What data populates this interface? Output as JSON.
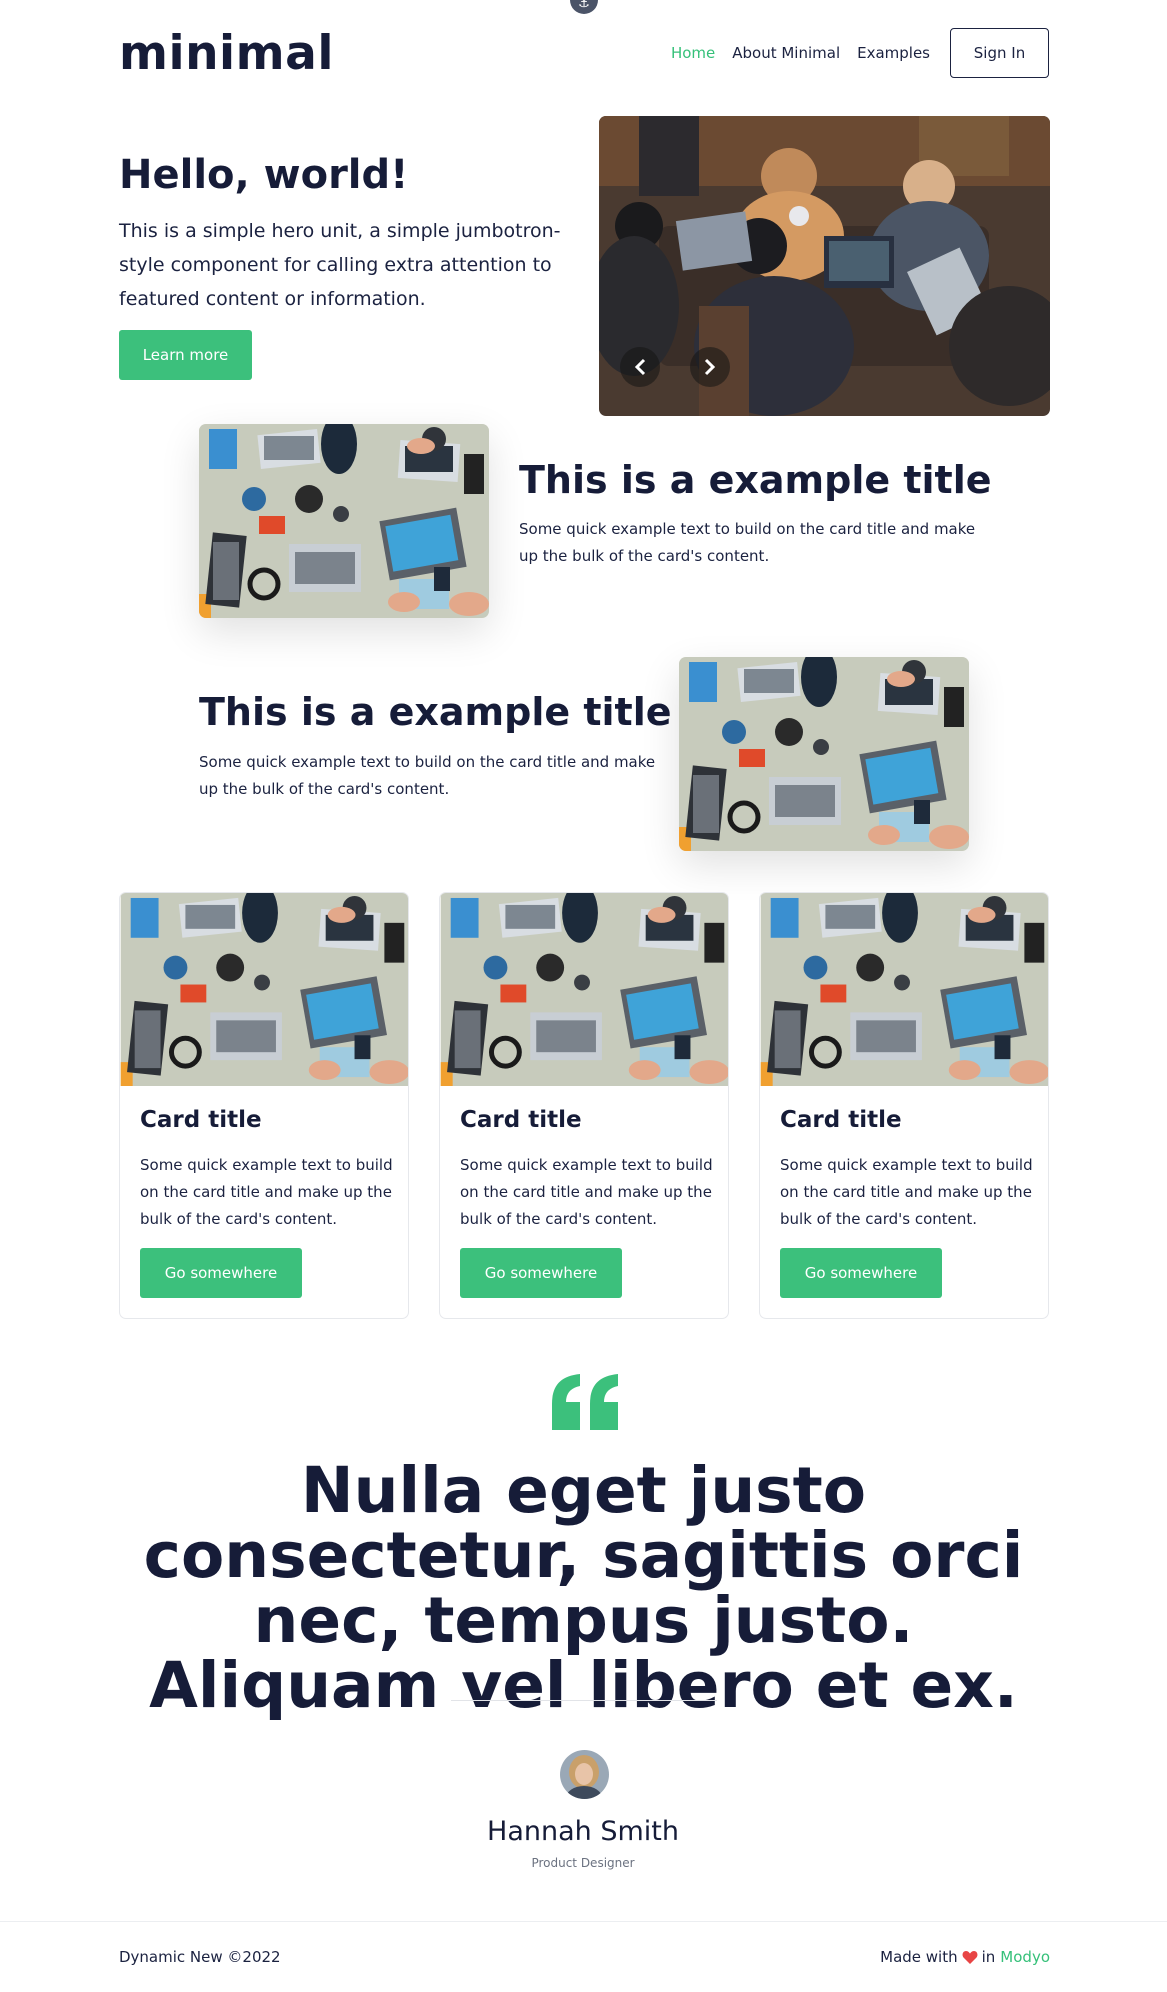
{
  "header": {
    "logo": "minimal",
    "nav": [
      {
        "label": "Home",
        "active": true
      },
      {
        "label": "About Minimal",
        "active": false
      },
      {
        "label": "Examples",
        "active": false
      }
    ],
    "signin_label": "Sign In"
  },
  "hero": {
    "title": "Hello, world!",
    "text": "This is a simple hero unit, a simple jumbotron-style component for calling extra attention to featured content or information.",
    "button_label": "Learn more"
  },
  "features": [
    {
      "title": "This is a example title",
      "text": "Some quick example text to build on the card title and make up the bulk of the card's content."
    },
    {
      "title": "This is a example title",
      "text": "Some quick example text to build on the card title and make up the bulk of the card's content."
    }
  ],
  "cards": [
    {
      "title": "Card title",
      "text": "Some quick example text to build on the card title and make up the bulk of the card's content.",
      "button_label": "Go somewhere"
    },
    {
      "title": "Card title",
      "text": "Some quick example text to build on the card title and make up the bulk of the card's content.",
      "button_label": "Go somewhere"
    },
    {
      "title": "Card title",
      "text": "Some quick example text to build on the card title and make up the bulk of the card's content.",
      "button_label": "Go somewhere"
    }
  ],
  "quote": {
    "text": "Nulla eget justo consectetur, sagittis orci nec, tempus justo. Aliquam vel libero et ex.",
    "author_name": "Hannah Smith",
    "author_role": "Product Designer"
  },
  "footer": {
    "copyright": "Dynamic New ©2022",
    "made_with": "Made with",
    "in_text": "in",
    "brand": "Modyo"
  },
  "colors": {
    "accent": "#3cc07c",
    "text_dark": "#161c38",
    "heart": "#e84545"
  },
  "icons": [
    "anchor-icon",
    "chevron-left-icon",
    "chevron-right-icon",
    "quote-icon",
    "heart-icon"
  ]
}
